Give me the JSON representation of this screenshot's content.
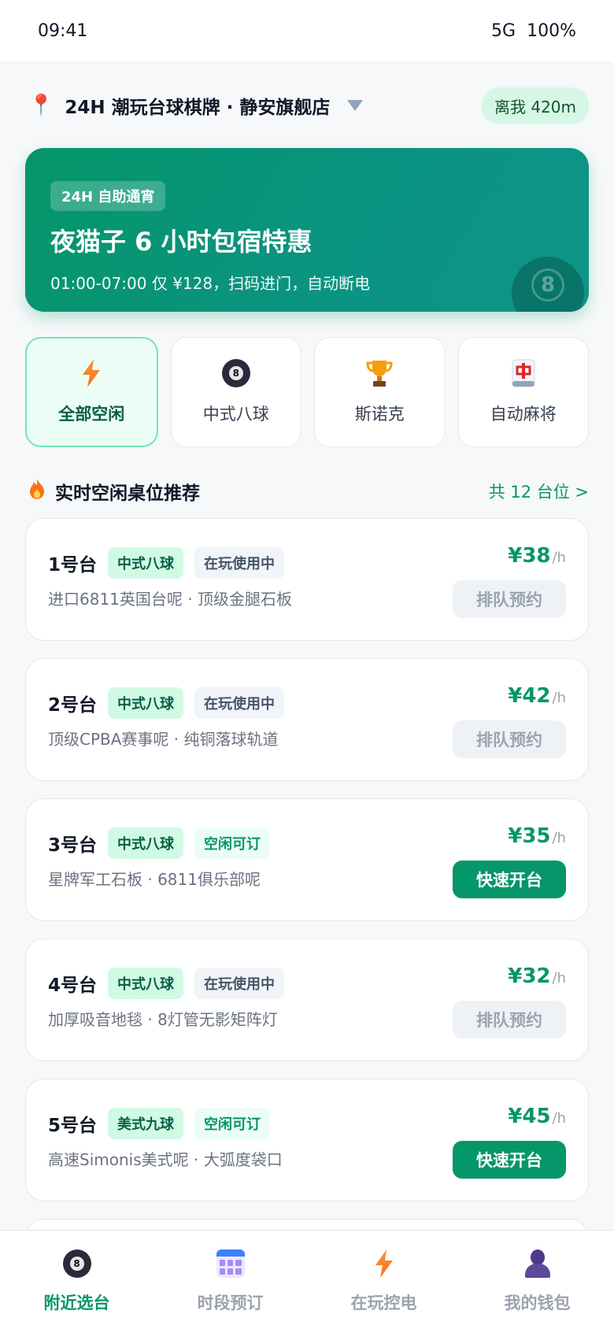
{
  "status_bar": {
    "time": "09:41",
    "network": "5G",
    "battery": "100%"
  },
  "store": {
    "name": "24H 潮玩台球棋牌 · 静安旗舰店",
    "distance": "离我 420m"
  },
  "banner": {
    "tag": "24H 自助通宵",
    "title": "夜猫子 6 小时包宿特惠",
    "subtitle": "01:00-07:00 仅 ¥128，扫码进门，自动断电",
    "ball_number": "8"
  },
  "categories": [
    {
      "label": "全部空闲",
      "icon": "lightning-icon",
      "active": true
    },
    {
      "label": "中式八球",
      "icon": "eight-ball-icon",
      "active": false
    },
    {
      "label": "斯诺克",
      "icon": "trophy-icon",
      "active": false
    },
    {
      "label": "自动麻将",
      "icon": "mahjong-icon",
      "active": false
    }
  ],
  "section": {
    "title": "实时空闲桌位推荐",
    "count_link": "共 12 台位 >"
  },
  "tables": [
    {
      "name": "1号台",
      "type": "中式八球",
      "status": "在玩使用中",
      "desc": "进口6811英国台呢 · 顶级金腿石板",
      "price": "¥38",
      "unit": "/h",
      "action": "排队预约",
      "available": false
    },
    {
      "name": "2号台",
      "type": "中式八球",
      "status": "在玩使用中",
      "desc": "顶级CPBA赛事呢 · 纯铜落球轨道",
      "price": "¥42",
      "unit": "/h",
      "action": "排队预约",
      "available": false
    },
    {
      "name": "3号台",
      "type": "中式八球",
      "status": "空闲可订",
      "desc": "星牌军工石板 · 6811俱乐部呢",
      "price": "¥35",
      "unit": "/h",
      "action": "快速开台",
      "available": true
    },
    {
      "name": "4号台",
      "type": "中式八球",
      "status": "在玩使用中",
      "desc": "加厚吸音地毯 · 8灯管无影矩阵灯",
      "price": "¥32",
      "unit": "/h",
      "action": "排队预约",
      "available": false
    },
    {
      "name": "5号台",
      "type": "美式九球",
      "status": "空闲可订",
      "desc": "高速Simonis美式呢 · 大弧度袋口",
      "price": "¥45",
      "unit": "/h",
      "action": "快速开台",
      "available": true
    }
  ],
  "tabbar": [
    {
      "label": "附近选台",
      "icon": "eight-ball-icon",
      "active": true
    },
    {
      "label": "时段预订",
      "icon": "calendar-icon",
      "active": false
    },
    {
      "label": "在玩控电",
      "icon": "lightning-icon",
      "active": false
    },
    {
      "label": "我的钱包",
      "icon": "user-icon",
      "active": false
    }
  ],
  "colors": {
    "accent": "#059669",
    "accent_light": "#d1fae5",
    "muted": "#9ca3af"
  }
}
